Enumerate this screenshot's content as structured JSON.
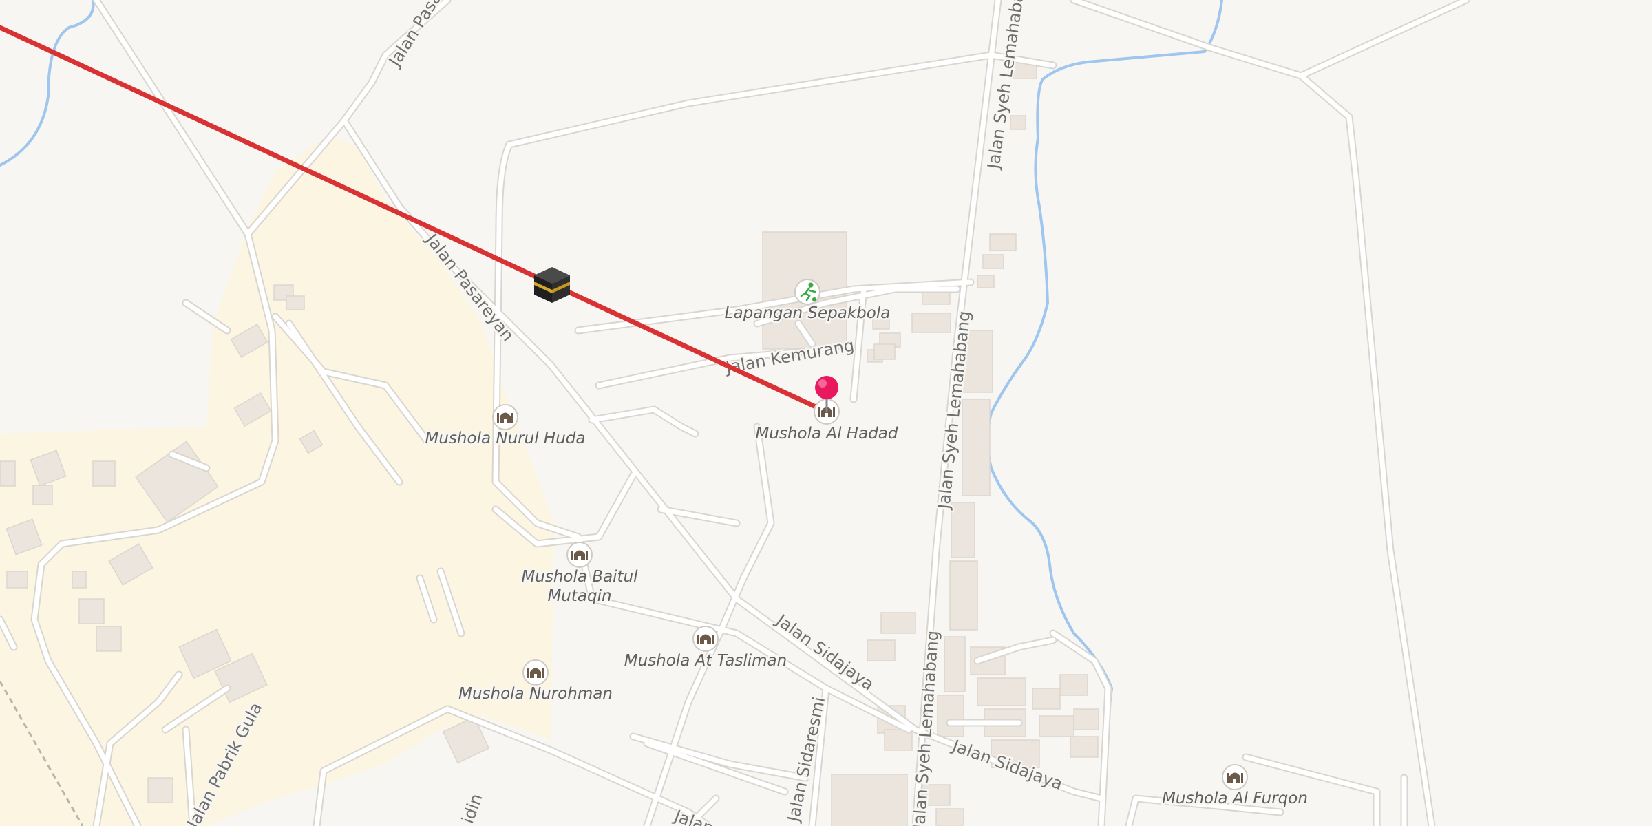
{
  "map": {
    "streets": [
      {
        "id": "jalan-pasareyan-top",
        "label": "Jalan Pasar"
      },
      {
        "id": "jalan-pasareyan",
        "label": "Jalan Pasareyan"
      },
      {
        "id": "jalan-kemurang",
        "label": "Jalan Kemurang"
      },
      {
        "id": "jalan-syeh-lemahabang-top",
        "label": "Jalan Syeh Lemahaba"
      },
      {
        "id": "jalan-syeh-lemahabang-mid",
        "label": "Jalan Syeh Lemahabang"
      },
      {
        "id": "jalan-syeh-lemahabang-bottom",
        "label": "Jalan Syeh Lemahabang"
      },
      {
        "id": "jalan-sidajaya-1",
        "label": "Jalan Sidajaya"
      },
      {
        "id": "jalan-sidajaya-2",
        "label": "Jalan Sidajaya"
      },
      {
        "id": "jalan-sidaresmi",
        "label": "Jalan Sidaresmi"
      },
      {
        "id": "jalan-pabrik-gula",
        "label": "Jalan Pabrik Gula"
      },
      {
        "id": "jalan-bottom",
        "label": "Jalan A"
      },
      {
        "id": "jalan-bottom-left",
        "label": "idin"
      }
    ],
    "pois": [
      {
        "id": "lapangan-sepakbola",
        "label": "Lapangan Sepakbola",
        "icon": "soccer-field-icon",
        "color": "#3aa845"
      },
      {
        "id": "mushola-al-hadad",
        "label": "Mushola Al Hadad",
        "icon": "mosque-icon",
        "color": "#6b5a4a"
      },
      {
        "id": "mushola-nurul-huda",
        "label": "Mushola Nurul Huda",
        "icon": "mosque-icon",
        "color": "#6b5a4a"
      },
      {
        "id": "mushola-baitul-mutaqin",
        "label_line1": "Mushola Baitul",
        "label_line2": "Mutaqin",
        "icon": "mosque-icon",
        "color": "#6b5a4a"
      },
      {
        "id": "mushola-at-tasliman",
        "label": "Mushola At Tasliman",
        "icon": "mosque-icon",
        "color": "#6b5a4a"
      },
      {
        "id": "mushola-nurohman",
        "label": "Mushola Nurohman",
        "icon": "mosque-icon",
        "color": "#6b5a4a"
      },
      {
        "id": "mushola-al-furqon",
        "label": "Mushola Al Furqon",
        "icon": "mosque-icon",
        "color": "#6b5a4a"
      }
    ],
    "markers": {
      "kaaba": {
        "icon": "kaaba-icon"
      },
      "location_pin": {
        "icon": "location-pin-icon",
        "color": "#e8195f"
      }
    },
    "qibla_line": {
      "color": "#d93235"
    },
    "colors": {
      "background": "#f8f6f2",
      "residential_area": "#fcf5e1",
      "road": "#ffffff",
      "water": "#9fc6ee",
      "building": "#ebe5de"
    }
  }
}
